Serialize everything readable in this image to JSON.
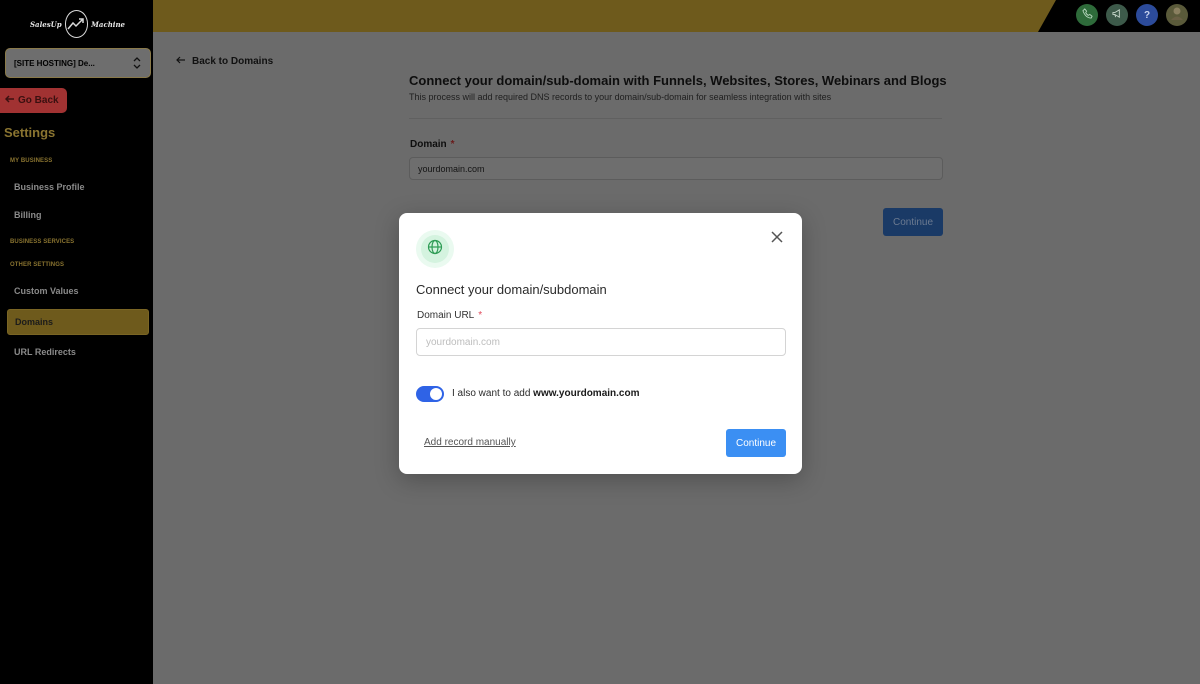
{
  "sidebar": {
    "logo_left": "SalesUp",
    "logo_right": "Machine",
    "location": "[SITE HOSTING] De...",
    "go_back": "Go Back",
    "title": "Settings",
    "sections": {
      "my_business": "MY BUSINESS",
      "business_services": "BUSINESS SERVICES",
      "other_settings": "OTHER SETTINGS"
    },
    "items": {
      "business_profile": "Business Profile",
      "billing": "Billing",
      "custom_values": "Custom Values",
      "domains": "Domains",
      "url_redirects": "URL Redirects"
    }
  },
  "header": {
    "icons": [
      "phone-icon",
      "megaphone-icon",
      "help-icon",
      "avatar"
    ],
    "colors": {
      "phone": "#2e6b3a",
      "megaphone": "#3d5a4a",
      "help": "#2c4b9a"
    }
  },
  "main": {
    "back_link": "Back to Domains",
    "title": "Connect your domain/sub-domain with Funnels, Websites, Stores, Webinars and Blogs",
    "subtitle": "This process will add required DNS records to your domain/sub-domain for seamless integration with sites",
    "domain_label": "Domain",
    "domain_value": "yourdomain.com",
    "continue": "Continue"
  },
  "modal": {
    "title": "Connect your domain/subdomain",
    "url_label": "Domain URL",
    "url_placeholder": "yourdomain.com",
    "toggle_text": "I also want to add",
    "toggle_domain": "www.yourdomain.com",
    "toggle_on": true,
    "manual_link": "Add record manually",
    "continue": "Continue"
  },
  "colors": {
    "accent": "#3b8ff3",
    "brand_gold": "#d4af37",
    "toggle": "#2f63e6",
    "required": "#e0495a"
  }
}
